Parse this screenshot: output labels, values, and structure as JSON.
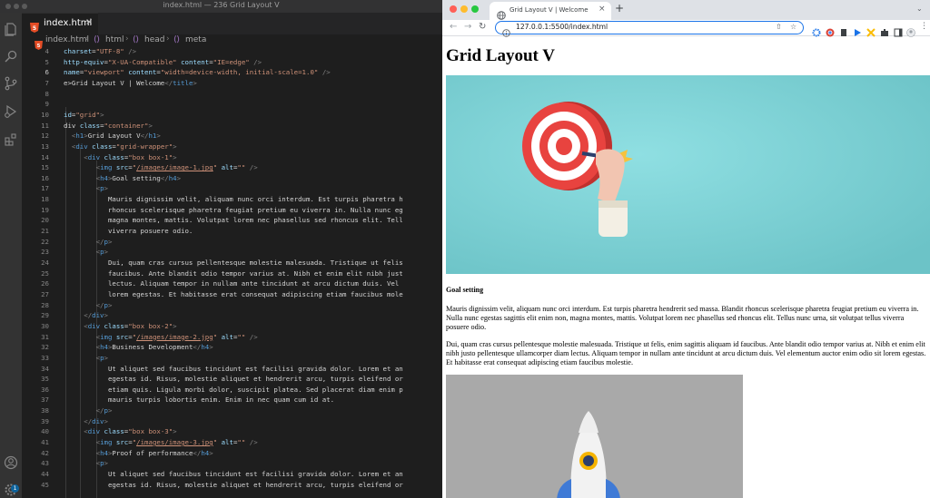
{
  "editor": {
    "window_title": "index.html — 236 Grid Layout V",
    "tab_label": "index.html",
    "tab_close": "×",
    "breadcrumb": [
      "index.html",
      "html",
      "head",
      "meta"
    ],
    "badge_count": "1",
    "lines": [
      {
        "n": "4",
        "segs": [
          [
            "t-attr",
            "charset"
          ],
          [
            "t-txt",
            "="
          ],
          [
            "t-str",
            "\"UTF-8\""
          ],
          [
            "t-txt",
            " "
          ],
          [
            "t-br",
            "/>"
          ]
        ]
      },
      {
        "n": "5",
        "segs": [
          [
            "t-attr",
            "http-equiv"
          ],
          [
            "t-txt",
            "="
          ],
          [
            "t-str",
            "\"X-UA-Compatible\""
          ],
          [
            "t-txt",
            " "
          ],
          [
            "t-attr",
            "content"
          ],
          [
            "t-txt",
            "="
          ],
          [
            "t-str",
            "\"IE=edge\""
          ],
          [
            "t-txt",
            " "
          ],
          [
            "t-br",
            "/>"
          ]
        ]
      },
      {
        "n": "6",
        "segs": [
          [
            "t-attr",
            "name"
          ],
          [
            "t-txt",
            "="
          ],
          [
            "t-str",
            "\"viewport\""
          ],
          [
            "t-txt",
            " "
          ],
          [
            "t-attr",
            "content"
          ],
          [
            "t-txt",
            "="
          ],
          [
            "t-str",
            "\"width=device-width, initial-scale=1.0\""
          ],
          [
            "t-txt",
            " "
          ],
          [
            "t-br",
            "/>"
          ]
        ]
      },
      {
        "n": "7",
        "segs": [
          [
            "t-txt",
            "e>Grid Layout V | Welcome"
          ],
          [
            "t-br",
            "</"
          ],
          [
            "t-tag",
            "title"
          ],
          [
            "t-br",
            ">"
          ]
        ]
      },
      {
        "n": "8",
        "segs": []
      },
      {
        "n": "9",
        "segs": []
      },
      {
        "n": "10",
        "segs": [
          [
            "t-attr",
            "id"
          ],
          [
            "t-txt",
            "="
          ],
          [
            "t-str",
            "\"grid\""
          ],
          [
            "t-br",
            ">"
          ]
        ]
      },
      {
        "n": "11",
        "segs": [
          [
            "t-txt",
            "div "
          ],
          [
            "t-attr",
            "class"
          ],
          [
            "t-txt",
            "="
          ],
          [
            "t-str",
            "\"container\""
          ],
          [
            "t-br",
            ">"
          ]
        ]
      },
      {
        "n": "12",
        "segs": [
          [
            "t-txt",
            "  "
          ],
          [
            "t-br",
            "<"
          ],
          [
            "t-tag",
            "h1"
          ],
          [
            "t-br",
            ">"
          ],
          [
            "t-txt",
            "Grid Layout V"
          ],
          [
            "t-br",
            "</"
          ],
          [
            "t-tag",
            "h1"
          ],
          [
            "t-br",
            ">"
          ]
        ]
      },
      {
        "n": "13",
        "segs": [
          [
            "t-txt",
            "  "
          ],
          [
            "t-br",
            "<"
          ],
          [
            "t-tag",
            "div"
          ],
          [
            "t-txt",
            " "
          ],
          [
            "t-attr",
            "class"
          ],
          [
            "t-txt",
            "="
          ],
          [
            "t-str",
            "\"grid-wrapper\""
          ],
          [
            "t-br",
            ">"
          ]
        ]
      },
      {
        "n": "14",
        "segs": [
          [
            "t-txt",
            "     "
          ],
          [
            "t-br",
            "<"
          ],
          [
            "t-tag",
            "div"
          ],
          [
            "t-txt",
            " "
          ],
          [
            "t-attr",
            "class"
          ],
          [
            "t-txt",
            "="
          ],
          [
            "t-str",
            "\"box box-1\""
          ],
          [
            "t-br",
            ">"
          ]
        ]
      },
      {
        "n": "15",
        "segs": [
          [
            "t-txt",
            "        "
          ],
          [
            "t-br",
            "<"
          ],
          [
            "t-tag",
            "img"
          ],
          [
            "t-txt",
            " "
          ],
          [
            "t-attr",
            "src"
          ],
          [
            "t-txt",
            "="
          ],
          [
            "t-str",
            "\""
          ],
          [
            "t-link",
            "/images/image-1.jpg"
          ],
          [
            "t-str",
            "\""
          ],
          [
            "t-txt",
            " "
          ],
          [
            "t-attr",
            "alt"
          ],
          [
            "t-txt",
            "="
          ],
          [
            "t-str",
            "\"\""
          ],
          [
            "t-txt",
            " "
          ],
          [
            "t-br",
            "/>"
          ]
        ]
      },
      {
        "n": "16",
        "segs": [
          [
            "t-txt",
            "        "
          ],
          [
            "t-br",
            "<"
          ],
          [
            "t-tag",
            "h4"
          ],
          [
            "t-br",
            ">"
          ],
          [
            "t-txt",
            "Goal setting"
          ],
          [
            "t-br",
            "</"
          ],
          [
            "t-tag",
            "h4"
          ],
          [
            "t-br",
            ">"
          ]
        ]
      },
      {
        "n": "17",
        "segs": [
          [
            "t-txt",
            "        "
          ],
          [
            "t-br",
            "<"
          ],
          [
            "t-tag",
            "p"
          ],
          [
            "t-br",
            ">"
          ]
        ]
      },
      {
        "n": "18",
        "segs": [
          [
            "t-txt",
            "           Mauris dignissim velit, aliquam nunc orci interdum. Est turpis pharetra h"
          ]
        ]
      },
      {
        "n": "19",
        "segs": [
          [
            "t-txt",
            "           rhoncus scelerisque pharetra feugiat pretium eu viverra in. Nulla nunc eg"
          ]
        ]
      },
      {
        "n": "20",
        "segs": [
          [
            "t-txt",
            "           magna montes, mattis. Volutpat lorem nec phasellus sed rhoncus elit. Tell"
          ]
        ]
      },
      {
        "n": "21",
        "segs": [
          [
            "t-txt",
            "           viverra posuere odio."
          ]
        ]
      },
      {
        "n": "22",
        "segs": [
          [
            "t-txt",
            "        "
          ],
          [
            "t-br",
            "</"
          ],
          [
            "t-tag",
            "p"
          ],
          [
            "t-br",
            ">"
          ]
        ]
      },
      {
        "n": "23",
        "segs": [
          [
            "t-txt",
            "        "
          ],
          [
            "t-br",
            "<"
          ],
          [
            "t-tag",
            "p"
          ],
          [
            "t-br",
            ">"
          ]
        ]
      },
      {
        "n": "24",
        "segs": [
          [
            "t-txt",
            "           Dui, quam cras cursus pellentesque molestie malesuada. Tristique ut felis"
          ]
        ]
      },
      {
        "n": "25",
        "segs": [
          [
            "t-txt",
            "           faucibus. Ante blandit odio tempor varius at. Nibh et enim elit nibh just"
          ]
        ]
      },
      {
        "n": "26",
        "segs": [
          [
            "t-txt",
            "           lectus. Aliquam tempor in nullam ante tincidunt at arcu dictum duis. Vel "
          ]
        ]
      },
      {
        "n": "27",
        "segs": [
          [
            "t-txt",
            "           lorem egestas. Et habitasse erat consequat adipiscing etiam faucibus mole"
          ]
        ]
      },
      {
        "n": "28",
        "segs": [
          [
            "t-txt",
            "        "
          ],
          [
            "t-br",
            "</"
          ],
          [
            "t-tag",
            "p"
          ],
          [
            "t-br",
            ">"
          ]
        ]
      },
      {
        "n": "29",
        "segs": [
          [
            "t-txt",
            "     "
          ],
          [
            "t-br",
            "</"
          ],
          [
            "t-tag",
            "div"
          ],
          [
            "t-br",
            ">"
          ]
        ]
      },
      {
        "n": "30",
        "segs": [
          [
            "t-txt",
            "     "
          ],
          [
            "t-br",
            "<"
          ],
          [
            "t-tag",
            "div"
          ],
          [
            "t-txt",
            " "
          ],
          [
            "t-attr",
            "class"
          ],
          [
            "t-txt",
            "="
          ],
          [
            "t-str",
            "\"box box-2\""
          ],
          [
            "t-br",
            ">"
          ]
        ]
      },
      {
        "n": "31",
        "segs": [
          [
            "t-txt",
            "        "
          ],
          [
            "t-br",
            "<"
          ],
          [
            "t-tag",
            "img"
          ],
          [
            "t-txt",
            " "
          ],
          [
            "t-attr",
            "src"
          ],
          [
            "t-txt",
            "="
          ],
          [
            "t-str",
            "\""
          ],
          [
            "t-link",
            "/images/image-2.jpg"
          ],
          [
            "t-str",
            "\""
          ],
          [
            "t-txt",
            " "
          ],
          [
            "t-attr",
            "alt"
          ],
          [
            "t-txt",
            "="
          ],
          [
            "t-str",
            "\"\""
          ],
          [
            "t-txt",
            " "
          ],
          [
            "t-br",
            "/>"
          ]
        ]
      },
      {
        "n": "32",
        "segs": [
          [
            "t-txt",
            "        "
          ],
          [
            "t-br",
            "<"
          ],
          [
            "t-tag",
            "h4"
          ],
          [
            "t-br",
            ">"
          ],
          [
            "t-txt",
            "Business Development"
          ],
          [
            "t-br",
            "</"
          ],
          [
            "t-tag",
            "h4"
          ],
          [
            "t-br",
            ">"
          ]
        ]
      },
      {
        "n": "33",
        "segs": [
          [
            "t-txt",
            "        "
          ],
          [
            "t-br",
            "<"
          ],
          [
            "t-tag",
            "p"
          ],
          [
            "t-br",
            ">"
          ]
        ]
      },
      {
        "n": "34",
        "segs": [
          [
            "t-txt",
            "           Ut aliquet sed faucibus tincidunt est facilisi gravida dolor. Lorem et an"
          ]
        ]
      },
      {
        "n": "35",
        "segs": [
          [
            "t-txt",
            "           egestas id. Risus, molestie aliquet et hendrerit arcu, turpis eleifend or"
          ]
        ]
      },
      {
        "n": "36",
        "segs": [
          [
            "t-txt",
            "           etiam quis. Ligula morbi dolor, suscipit platea. Sed placerat diam enim p"
          ]
        ]
      },
      {
        "n": "37",
        "segs": [
          [
            "t-txt",
            "           mauris turpis lobortis enim. Enim in nec quam cum id at."
          ]
        ]
      },
      {
        "n": "38",
        "segs": [
          [
            "t-txt",
            "        "
          ],
          [
            "t-br",
            "</"
          ],
          [
            "t-tag",
            "p"
          ],
          [
            "t-br",
            ">"
          ]
        ]
      },
      {
        "n": "39",
        "segs": [
          [
            "t-txt",
            "     "
          ],
          [
            "t-br",
            "</"
          ],
          [
            "t-tag",
            "div"
          ],
          [
            "t-br",
            ">"
          ]
        ]
      },
      {
        "n": "40",
        "segs": [
          [
            "t-txt",
            "     "
          ],
          [
            "t-br",
            "<"
          ],
          [
            "t-tag",
            "div"
          ],
          [
            "t-txt",
            " "
          ],
          [
            "t-attr",
            "class"
          ],
          [
            "t-txt",
            "="
          ],
          [
            "t-str",
            "\"box box-3\""
          ],
          [
            "t-br",
            ">"
          ]
        ]
      },
      {
        "n": "41",
        "segs": [
          [
            "t-txt",
            "        "
          ],
          [
            "t-br",
            "<"
          ],
          [
            "t-tag",
            "img"
          ],
          [
            "t-txt",
            " "
          ],
          [
            "t-attr",
            "src"
          ],
          [
            "t-txt",
            "="
          ],
          [
            "t-str",
            "\""
          ],
          [
            "t-link",
            "/images/image-3.jpg"
          ],
          [
            "t-str",
            "\""
          ],
          [
            "t-txt",
            " "
          ],
          [
            "t-attr",
            "alt"
          ],
          [
            "t-txt",
            "="
          ],
          [
            "t-str",
            "\"\""
          ],
          [
            "t-txt",
            " "
          ],
          [
            "t-br",
            "/>"
          ]
        ]
      },
      {
        "n": "42",
        "segs": [
          [
            "t-txt",
            "        "
          ],
          [
            "t-br",
            "<"
          ],
          [
            "t-tag",
            "h4"
          ],
          [
            "t-br",
            ">"
          ],
          [
            "t-txt",
            "Proof of performance"
          ],
          [
            "t-br",
            "</"
          ],
          [
            "t-tag",
            "h4"
          ],
          [
            "t-br",
            ">"
          ]
        ]
      },
      {
        "n": "43",
        "segs": [
          [
            "t-txt",
            "        "
          ],
          [
            "t-br",
            "<"
          ],
          [
            "t-tag",
            "p"
          ],
          [
            "t-br",
            ">"
          ]
        ]
      },
      {
        "n": "44",
        "segs": [
          [
            "t-txt",
            "           Ut aliquet sed faucibus tincidunt est facilisi gravida dolor. Lorem et an"
          ]
        ]
      },
      {
        "n": "45",
        "segs": [
          [
            "t-txt",
            "           egestas id. Risus, molestie aliquet et hendrerit arcu, turpis eleifend or"
          ]
        ]
      }
    ],
    "active_line": "6"
  },
  "browser": {
    "tab_title": "Grid Layout V | Welcome",
    "tab_close": "×",
    "new_tab": "+",
    "url": "127.0.0.1:5500/index.html",
    "page": {
      "h1": "Grid Layout V",
      "h4": "Goal setting",
      "p1": "Mauris dignissim velit, aliquam nunc orci interdum. Est turpis pharetra hendrerit sed massa. Blandit rhoncus scelerisque pharetra feugiat pretium eu viverra in. Nulla nunc egestas sagittis elit enim non, magna montes, mattis. Volutpat lorem nec phasellus sed rhoncus elit. Tellus nunc urna, sit volutpat tellus viverra posuere odio.",
      "p2": "Dui, quam cras cursus pellentesque molestie malesuada. Tristique ut felis, enim sagittis aliquam id faucibus. Ante blandit odio tempor varius at. Nibh et enim elit nibh justo pellentesque ullamcorper diam lectus. Aliquam tempor in nullam ante tincidunt at arcu dictum duis. Vel elementum auctor enim odio sit lorem egestas. Et habitasse erat consequat adipiscing etiam faucibus molestie."
    }
  },
  "colors": {
    "vscode_bg": "#1e1e1e",
    "activity_bar": "#333333",
    "tag": "#569cd6",
    "attr": "#9cdcfe",
    "string": "#ce9178",
    "omnibox_focus": "#1a73e8",
    "image1_bg": "#7fd3d6",
    "image2_bg": "#a9a9a9"
  }
}
